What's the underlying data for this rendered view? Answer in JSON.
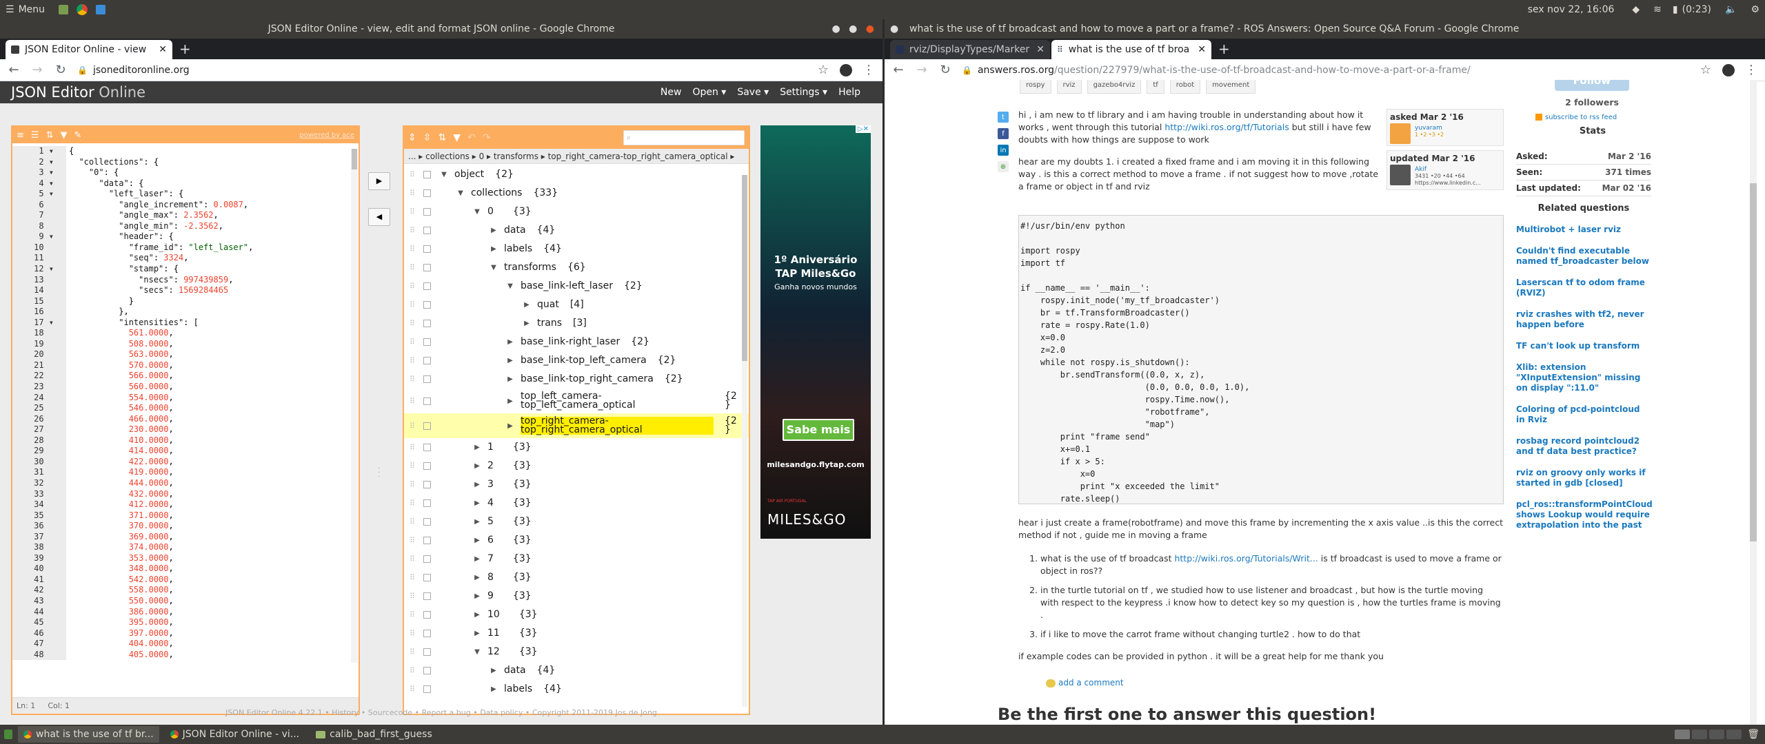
{
  "panel": {
    "menu": "Menu",
    "clock": "sex nov 22, 16:06",
    "battery": "(0:23)"
  },
  "taskbar": {
    "items": [
      "what is the use of tf br...",
      "JSON Editor Online - vi...",
      "calib_bad_first_guess"
    ]
  },
  "left_window": {
    "title": "JSON Editor Online - view, edit and format JSON online - Google Chrome",
    "tab": "JSON Editor Online - view",
    "url": "jsoneditoronline.org"
  },
  "editor": {
    "brand_a": "JSON Editor",
    "brand_b": " Online",
    "menu": [
      "New",
      "Open ▾",
      "Save ▾",
      "Settings ▾",
      "Help"
    ],
    "powered": "powered by ace",
    "status": {
      "ln": "Ln: 1",
      "col": "Col: 1"
    },
    "footer": "JSON Editor Online 4.22.1 • History • Sourcecode • Report a bug • Data policy • Copyright 2011-2019 Jos de Jong",
    "breadcrumb": "... ▸ collections ▸ 0 ▸ transforms ▸ top_right_camera-top_right_camera_optical ▸",
    "code_lines": [
      [
        "{"
      ],
      [
        "  ",
        "\"collections\"",
        ": {"
      ],
      [
        "    ",
        "\"0\"",
        ": {"
      ],
      [
        "      ",
        "\"data\"",
        ": {"
      ],
      [
        "        ",
        "\"left_laser\"",
        ": {"
      ],
      [
        "          ",
        "\"angle_increment\"",
        ": ",
        "0.0087",
        ","
      ],
      [
        "          ",
        "\"angle_max\"",
        ": ",
        "2.3562",
        ","
      ],
      [
        "          ",
        "\"angle_min\"",
        ": ",
        "-2.3562",
        ","
      ],
      [
        "          ",
        "\"header\"",
        ": {"
      ],
      [
        "            ",
        "\"frame_id\"",
        ": ",
        "\"left_laser\"",
        ","
      ],
      [
        "            ",
        "\"seq\"",
        ": ",
        "3324",
        ","
      ],
      [
        "            ",
        "\"stamp\"",
        ": {"
      ],
      [
        "              ",
        "\"nsecs\"",
        ": ",
        "997439859",
        ","
      ],
      [
        "              ",
        "\"secs\"",
        ": ",
        "1569284465"
      ],
      [
        "            }"
      ],
      [
        "          },"
      ],
      [
        "          ",
        "\"intensities\"",
        ": ["
      ],
      [
        "            ",
        "",
        "",
        "561.0000",
        ","
      ],
      [
        "            ",
        "",
        "",
        "508.0000",
        ","
      ],
      [
        "            ",
        "",
        "",
        "563.0000",
        ","
      ],
      [
        "            ",
        "",
        "",
        "570.0000",
        ","
      ],
      [
        "            ",
        "",
        "",
        "566.0000",
        ","
      ],
      [
        "            ",
        "",
        "",
        "560.0000",
        ","
      ],
      [
        "            ",
        "",
        "",
        "554.0000",
        ","
      ],
      [
        "            ",
        "",
        "",
        "546.0000",
        ","
      ],
      [
        "            ",
        "",
        "",
        "466.0000",
        ","
      ],
      [
        "            ",
        "",
        "",
        "230.0000",
        ","
      ],
      [
        "            ",
        "",
        "",
        "410.0000",
        ","
      ],
      [
        "            ",
        "",
        "",
        "414.0000",
        ","
      ],
      [
        "            ",
        "",
        "",
        "422.0000",
        ","
      ],
      [
        "            ",
        "",
        "",
        "419.0000",
        ","
      ],
      [
        "            ",
        "",
        "",
        "444.0000",
        ","
      ],
      [
        "            ",
        "",
        "",
        "432.0000",
        ","
      ],
      [
        "            ",
        "",
        "",
        "412.0000",
        ","
      ],
      [
        "            ",
        "",
        "",
        "371.0000",
        ","
      ],
      [
        "            ",
        "",
        "",
        "370.0000",
        ","
      ],
      [
        "            ",
        "",
        "",
        "369.0000",
        ","
      ],
      [
        "            ",
        "",
        "",
        "374.0000",
        ","
      ],
      [
        "            ",
        "",
        "",
        "353.0000",
        ","
      ],
      [
        "            ",
        "",
        "",
        "348.0000",
        ","
      ],
      [
        "            ",
        "",
        "",
        "542.0000",
        ","
      ],
      [
        "            ",
        "",
        "",
        "558.0000",
        ","
      ],
      [
        "            ",
        "",
        "",
        "550.0000",
        ","
      ],
      [
        "            ",
        "",
        "",
        "386.0000",
        ","
      ],
      [
        "            ",
        "",
        "",
        "395.0000",
        ","
      ],
      [
        "            ",
        "",
        "",
        "397.0000",
        ","
      ],
      [
        "            ",
        "",
        "",
        "404.0000",
        ","
      ],
      [
        "            ",
        "",
        "",
        "405.0000",
        ","
      ]
    ],
    "tree": [
      {
        "indent": 0,
        "arrow": "▼",
        "key": "object",
        "val": "{2}"
      },
      {
        "indent": 1,
        "arrow": "▼",
        "key": "collections",
        "val": "{33}"
      },
      {
        "indent": 2,
        "arrow": "▼",
        "key": "0",
        "val": "{3}"
      },
      {
        "indent": 3,
        "arrow": "▶",
        "key": "data",
        "val": "{4}"
      },
      {
        "indent": 3,
        "arrow": "▶",
        "key": "labels",
        "val": "{4}"
      },
      {
        "indent": 3,
        "arrow": "▼",
        "key": "transforms",
        "val": "{6}"
      },
      {
        "indent": 4,
        "arrow": "▼",
        "key": "base_link-left_laser",
        "val": "{2}"
      },
      {
        "indent": 5,
        "arrow": "▶",
        "key": "quat",
        "val": "[4]"
      },
      {
        "indent": 5,
        "arrow": "▶",
        "key": "trans",
        "val": "[3]"
      },
      {
        "indent": 4,
        "arrow": "▶",
        "key": "base_link-right_laser",
        "val": "{2}"
      },
      {
        "indent": 4,
        "arrow": "▶",
        "key": "base_link-top_left_camera",
        "val": "{2}"
      },
      {
        "indent": 4,
        "arrow": "▶",
        "key": "base_link-top_right_camera",
        "val": "{2}"
      },
      {
        "indent": 4,
        "arrow": "▶",
        "key": "top_left_camera-\ntop_left_camera_optical",
        "val": "{2\n}",
        "tall": true
      },
      {
        "indent": 4,
        "arrow": "▶",
        "key": "top_right_camera-\ntop_right_camera_optical",
        "val": "{2\n}",
        "tall": true,
        "highlight": true
      },
      {
        "indent": 2,
        "arrow": "▶",
        "key": "1",
        "val": "{3}"
      },
      {
        "indent": 2,
        "arrow": "▶",
        "key": "2",
        "val": "{3}"
      },
      {
        "indent": 2,
        "arrow": "▶",
        "key": "3",
        "val": "{3}"
      },
      {
        "indent": 2,
        "arrow": "▶",
        "key": "4",
        "val": "{3}"
      },
      {
        "indent": 2,
        "arrow": "▶",
        "key": "5",
        "val": "{3}"
      },
      {
        "indent": 2,
        "arrow": "▶",
        "key": "6",
        "val": "{3}"
      },
      {
        "indent": 2,
        "arrow": "▶",
        "key": "7",
        "val": "{3}"
      },
      {
        "indent": 2,
        "arrow": "▶",
        "key": "8",
        "val": "{3}"
      },
      {
        "indent": 2,
        "arrow": "▶",
        "key": "9",
        "val": "{3}"
      },
      {
        "indent": 2,
        "arrow": "▶",
        "key": "10",
        "val": "{3}"
      },
      {
        "indent": 2,
        "arrow": "▶",
        "key": "11",
        "val": "{3}"
      },
      {
        "indent": 2,
        "arrow": "▼",
        "key": "12",
        "val": "{3}"
      },
      {
        "indent": 3,
        "arrow": "▶",
        "key": "data",
        "val": "{4}"
      },
      {
        "indent": 3,
        "arrow": "▶",
        "key": "labels",
        "val": "{4}"
      }
    ]
  },
  "ad": {
    "title_line1": "1º Aniversário",
    "title_line2": "TAP Miles&Go",
    "subtitle": "Ganha novos mundos",
    "cta": "Sabe mais",
    "site": "milesandgo.flytap.com",
    "airline": "TAP AIR PORTUGAL",
    "logo": "MILES&GO"
  },
  "right_window": {
    "title": "what is the use of tf broadcast and how to move a part or a frame? - ROS Answers: Open Source Q&A Forum - Google Chrome",
    "tabs": [
      "rviz/DisplayTypes/Marker",
      "what is the use of tf broa"
    ],
    "url_host": "answers.ros.org",
    "url_path": "/question/227979/what-is-the-use-of-tf-broadcast-and-how-to-move-a-part-or-a-frame/"
  },
  "ros": {
    "tags": [
      "rospy",
      "rviz",
      "gazebo4rviz",
      "tf",
      "robot",
      "movement"
    ],
    "follow": "Follow",
    "followers": "2 followers",
    "rss": "subscribe to rss feed",
    "stats_title": "Stats",
    "stats": [
      {
        "k": "Asked:",
        "v": "Mar 2 '16"
      },
      {
        "k": "Seen:",
        "v": "371 times"
      },
      {
        "k": "Last updated:",
        "v": "Mar 02 '16"
      }
    ],
    "related_title": "Related questions",
    "related": [
      "Multirobot + laser rviz",
      "Couldn't find executable named tf_broadcaster below",
      "Laserscan tf to odom frame (RVIZ)",
      "rviz crashes with tf2, never happen before",
      "TF can't look up transform",
      "Xlib: extension \"XInputExtension\" missing on display \":11.0\"",
      "Coloring of pcd-pointcloud in Rviz",
      "rosbag record pointcloud2 and tf data best practice?",
      "rviz on groovy only works if started in gdb [closed]",
      "pcl_ros::transformPointCloud shows Lookup would require extrapolation into the past"
    ],
    "asked": {
      "label": "asked Mar 2 '16",
      "user": "yuvaram",
      "karma": "1 •2 •3 •2"
    },
    "updated": {
      "label": "updated Mar 2 '16",
      "user": "Akif",
      "karma": "3431 •20 •44 •64",
      "site": "https://www.linkedin.c..."
    },
    "p1_a": "hi , i am new to tf library and i am having trouble in understanding about how it works , went through this tutorial ",
    "p1_link": "http://wiki.ros.org/tf/Tutorials",
    "p1_b": " but still i have few doubts with how things are suppose to work",
    "p2": "hear are my doubts 1. i created a fixed frame and i am moving it in this following way . is this a correct method to move a frame . if not suggest how to move ,rotate a frame or object in tf and rviz",
    "code": "#!/usr/bin/env python\n\nimport rospy\nimport tf\n\nif __name__ == '__main__':\n    rospy.init_node('my_tf_broadcaster')\n    br = tf.TransformBroadcaster()\n    rate = rospy.Rate(1.0)\n    x=0.0\n    z=2.0\n    while not rospy.is_shutdown():\n        br.sendTransform((0.0, x, z),\n                         (0.0, 0.0, 0.0, 1.0),\n                         rospy.Time.now(),\n                         \"robotframe\",\n                         \"map\")\n        print \"frame send\"\n        x+=0.1\n        if x > 5:\n            x=0\n            print \"x exceeded the limit\"\n        rate.sleep()",
    "p3": "hear i just create a frame(robotframe) and move this frame by incrementing the x axis value ..is this the correct method if not , guide me in moving a frame",
    "li1_a": "what is the use of tf broadcast ",
    "li1_link": "http://wiki.ros.org/Tutorials/Writ...",
    "li1_b": " is tf broadcast is used to move a frame or object in ros??",
    "li2": "in the turtle tutorial on tf , we studied how to use listener and broadcast , but how is the turtle moving with respect to the keypress .i know how to detect key so my question is , how the turtles frame is moving .",
    "li3": "if i like to move the carrot frame without changing turtle2 . how to do that",
    "p4": "if example codes can be provided in python . it will be a great help for me thank you",
    "add_comment": "add a comment",
    "answer_heading": "Be the first one to answer this question!"
  }
}
